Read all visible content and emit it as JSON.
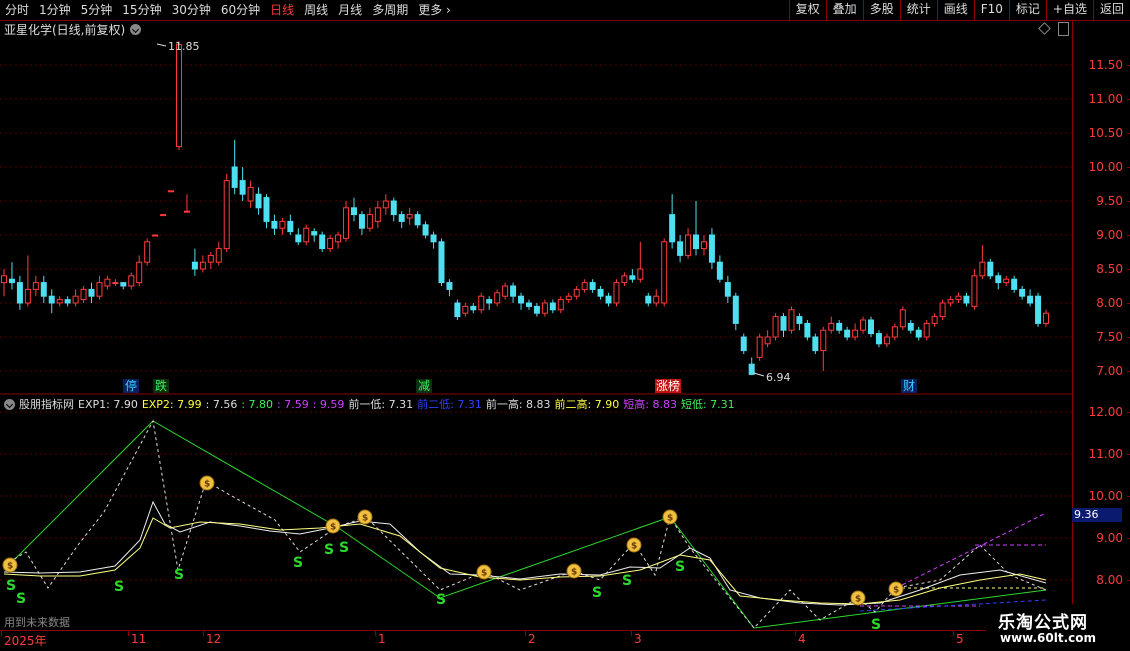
{
  "toolbar": {
    "periods": [
      "分时",
      "1分钟",
      "5分钟",
      "15分钟",
      "30分钟",
      "60分钟",
      "日线",
      "周线",
      "月线",
      "多周期",
      "更多"
    ],
    "active_period": "日线",
    "tools": [
      "复权",
      "叠加",
      "多股",
      "统计",
      "画线",
      "F10",
      "标记",
      "+自选",
      "返回"
    ]
  },
  "main_chart": {
    "title": "亚星化学(日线,前复权)",
    "y_ticks": [
      "11.50",
      "11.00",
      "10.50",
      "10.00",
      "9.50",
      "9.00",
      "8.50",
      "8.00",
      "7.50",
      "7.00"
    ],
    "high_label": "11.85",
    "low_label": "6.94",
    "event_tags": [
      {
        "text": "停",
        "color": "#3ad0ff",
        "bg": "#0a2060"
      },
      {
        "text": "跌",
        "color": "#3ef05a",
        "bg": "#0a3010"
      },
      {
        "text": "减",
        "color": "#3ef05a",
        "bg": "#0a3010"
      },
      {
        "text": "涨榜",
        "color": "#ffffff",
        "bg": "#c01010"
      },
      {
        "text": "财",
        "color": "#3ad0ff",
        "bg": "#0a2060"
      }
    ]
  },
  "indicator": {
    "name": "股朋指标网",
    "items": [
      {
        "text": "EXP1: 7.90",
        "color": "#dddddd"
      },
      {
        "text": "EXP2: 7.99",
        "color": "#ffff40"
      },
      {
        "text": ": 7.56",
        "color": "#dddddd"
      },
      {
        "text": ": 7.80",
        "color": "#3ef05a"
      },
      {
        "text": ": 7.59",
        "color": "#d040ff"
      },
      {
        "text": ": 9.59",
        "color": "#d040ff"
      },
      {
        "text": "前一低: 7.31",
        "color": "#dddddd"
      },
      {
        "text": "前二低: 7.31",
        "color": "#3040ff"
      },
      {
        "text": "前一高: 8.83",
        "color": "#dddddd"
      },
      {
        "text": "前二高: 7.90",
        "color": "#ffff40"
      },
      {
        "text": "短高: 8.83",
        "color": "#d040ff"
      },
      {
        "text": "短低: 7.31",
        "color": "#3ef05a"
      }
    ],
    "y_ticks": [
      "12.00",
      "11.00",
      "10.00",
      "9.00",
      "8.00"
    ],
    "current_value": "9.36",
    "note": "用到未来数据",
    "signal_letter": "S",
    "coin_symbol": "$"
  },
  "date_axis": {
    "labels": [
      "2025年",
      "11",
      "12",
      "1",
      "2",
      "3",
      "4",
      "5"
    ]
  },
  "watermark": {
    "line1": "乐淘公式网",
    "line2": "www.60lt.com"
  },
  "colors": {
    "up": "#ff3b3b",
    "down": "#4ee0f0",
    "grid": "#8a0000",
    "accent": "#ff3b3b"
  }
}
